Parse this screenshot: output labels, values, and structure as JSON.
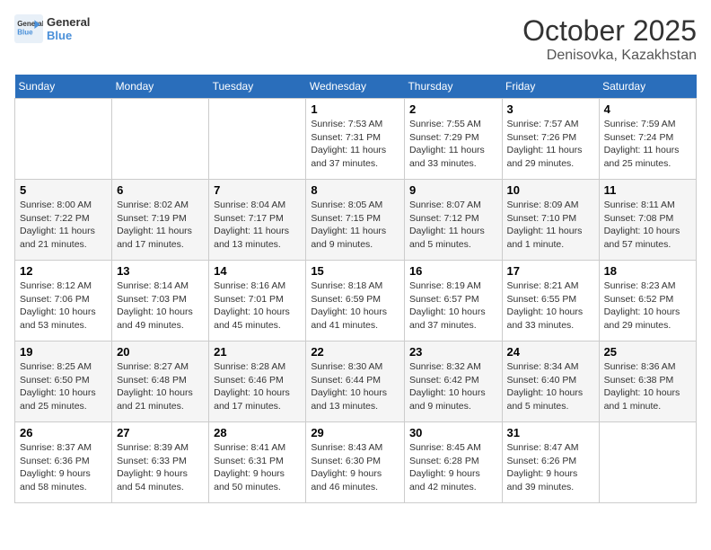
{
  "header": {
    "logo_line1": "General",
    "logo_line2": "Blue",
    "title": "October 2025",
    "subtitle": "Denisovka, Kazakhstan"
  },
  "days_of_week": [
    "Sunday",
    "Monday",
    "Tuesday",
    "Wednesday",
    "Thursday",
    "Friday",
    "Saturday"
  ],
  "weeks": [
    [
      {
        "day": "",
        "sunrise": "",
        "sunset": "",
        "daylight": ""
      },
      {
        "day": "",
        "sunrise": "",
        "sunset": "",
        "daylight": ""
      },
      {
        "day": "",
        "sunrise": "",
        "sunset": "",
        "daylight": ""
      },
      {
        "day": "1",
        "sunrise": "Sunrise: 7:53 AM",
        "sunset": "Sunset: 7:31 PM",
        "daylight": "Daylight: 11 hours and 37 minutes."
      },
      {
        "day": "2",
        "sunrise": "Sunrise: 7:55 AM",
        "sunset": "Sunset: 7:29 PM",
        "daylight": "Daylight: 11 hours and 33 minutes."
      },
      {
        "day": "3",
        "sunrise": "Sunrise: 7:57 AM",
        "sunset": "Sunset: 7:26 PM",
        "daylight": "Daylight: 11 hours and 29 minutes."
      },
      {
        "day": "4",
        "sunrise": "Sunrise: 7:59 AM",
        "sunset": "Sunset: 7:24 PM",
        "daylight": "Daylight: 11 hours and 25 minutes."
      }
    ],
    [
      {
        "day": "5",
        "sunrise": "Sunrise: 8:00 AM",
        "sunset": "Sunset: 7:22 PM",
        "daylight": "Daylight: 11 hours and 21 minutes."
      },
      {
        "day": "6",
        "sunrise": "Sunrise: 8:02 AM",
        "sunset": "Sunset: 7:19 PM",
        "daylight": "Daylight: 11 hours and 17 minutes."
      },
      {
        "day": "7",
        "sunrise": "Sunrise: 8:04 AM",
        "sunset": "Sunset: 7:17 PM",
        "daylight": "Daylight: 11 hours and 13 minutes."
      },
      {
        "day": "8",
        "sunrise": "Sunrise: 8:05 AM",
        "sunset": "Sunset: 7:15 PM",
        "daylight": "Daylight: 11 hours and 9 minutes."
      },
      {
        "day": "9",
        "sunrise": "Sunrise: 8:07 AM",
        "sunset": "Sunset: 7:12 PM",
        "daylight": "Daylight: 11 hours and 5 minutes."
      },
      {
        "day": "10",
        "sunrise": "Sunrise: 8:09 AM",
        "sunset": "Sunset: 7:10 PM",
        "daylight": "Daylight: 11 hours and 1 minute."
      },
      {
        "day": "11",
        "sunrise": "Sunrise: 8:11 AM",
        "sunset": "Sunset: 7:08 PM",
        "daylight": "Daylight: 10 hours and 57 minutes."
      }
    ],
    [
      {
        "day": "12",
        "sunrise": "Sunrise: 8:12 AM",
        "sunset": "Sunset: 7:06 PM",
        "daylight": "Daylight: 10 hours and 53 minutes."
      },
      {
        "day": "13",
        "sunrise": "Sunrise: 8:14 AM",
        "sunset": "Sunset: 7:03 PM",
        "daylight": "Daylight: 10 hours and 49 minutes."
      },
      {
        "day": "14",
        "sunrise": "Sunrise: 8:16 AM",
        "sunset": "Sunset: 7:01 PM",
        "daylight": "Daylight: 10 hours and 45 minutes."
      },
      {
        "day": "15",
        "sunrise": "Sunrise: 8:18 AM",
        "sunset": "Sunset: 6:59 PM",
        "daylight": "Daylight: 10 hours and 41 minutes."
      },
      {
        "day": "16",
        "sunrise": "Sunrise: 8:19 AM",
        "sunset": "Sunset: 6:57 PM",
        "daylight": "Daylight: 10 hours and 37 minutes."
      },
      {
        "day": "17",
        "sunrise": "Sunrise: 8:21 AM",
        "sunset": "Sunset: 6:55 PM",
        "daylight": "Daylight: 10 hours and 33 minutes."
      },
      {
        "day": "18",
        "sunrise": "Sunrise: 8:23 AM",
        "sunset": "Sunset: 6:52 PM",
        "daylight": "Daylight: 10 hours and 29 minutes."
      }
    ],
    [
      {
        "day": "19",
        "sunrise": "Sunrise: 8:25 AM",
        "sunset": "Sunset: 6:50 PM",
        "daylight": "Daylight: 10 hours and 25 minutes."
      },
      {
        "day": "20",
        "sunrise": "Sunrise: 8:27 AM",
        "sunset": "Sunset: 6:48 PM",
        "daylight": "Daylight: 10 hours and 21 minutes."
      },
      {
        "day": "21",
        "sunrise": "Sunrise: 8:28 AM",
        "sunset": "Sunset: 6:46 PM",
        "daylight": "Daylight: 10 hours and 17 minutes."
      },
      {
        "day": "22",
        "sunrise": "Sunrise: 8:30 AM",
        "sunset": "Sunset: 6:44 PM",
        "daylight": "Daylight: 10 hours and 13 minutes."
      },
      {
        "day": "23",
        "sunrise": "Sunrise: 8:32 AM",
        "sunset": "Sunset: 6:42 PM",
        "daylight": "Daylight: 10 hours and 9 minutes."
      },
      {
        "day": "24",
        "sunrise": "Sunrise: 8:34 AM",
        "sunset": "Sunset: 6:40 PM",
        "daylight": "Daylight: 10 hours and 5 minutes."
      },
      {
        "day": "25",
        "sunrise": "Sunrise: 8:36 AM",
        "sunset": "Sunset: 6:38 PM",
        "daylight": "Daylight: 10 hours and 1 minute."
      }
    ],
    [
      {
        "day": "26",
        "sunrise": "Sunrise: 8:37 AM",
        "sunset": "Sunset: 6:36 PM",
        "daylight": "Daylight: 9 hours and 58 minutes."
      },
      {
        "day": "27",
        "sunrise": "Sunrise: 8:39 AM",
        "sunset": "Sunset: 6:33 PM",
        "daylight": "Daylight: 9 hours and 54 minutes."
      },
      {
        "day": "28",
        "sunrise": "Sunrise: 8:41 AM",
        "sunset": "Sunset: 6:31 PM",
        "daylight": "Daylight: 9 hours and 50 minutes."
      },
      {
        "day": "29",
        "sunrise": "Sunrise: 8:43 AM",
        "sunset": "Sunset: 6:30 PM",
        "daylight": "Daylight: 9 hours and 46 minutes."
      },
      {
        "day": "30",
        "sunrise": "Sunrise: 8:45 AM",
        "sunset": "Sunset: 6:28 PM",
        "daylight": "Daylight: 9 hours and 42 minutes."
      },
      {
        "day": "31",
        "sunrise": "Sunrise: 8:47 AM",
        "sunset": "Sunset: 6:26 PM",
        "daylight": "Daylight: 9 hours and 39 minutes."
      },
      {
        "day": "",
        "sunrise": "",
        "sunset": "",
        "daylight": ""
      }
    ]
  ]
}
